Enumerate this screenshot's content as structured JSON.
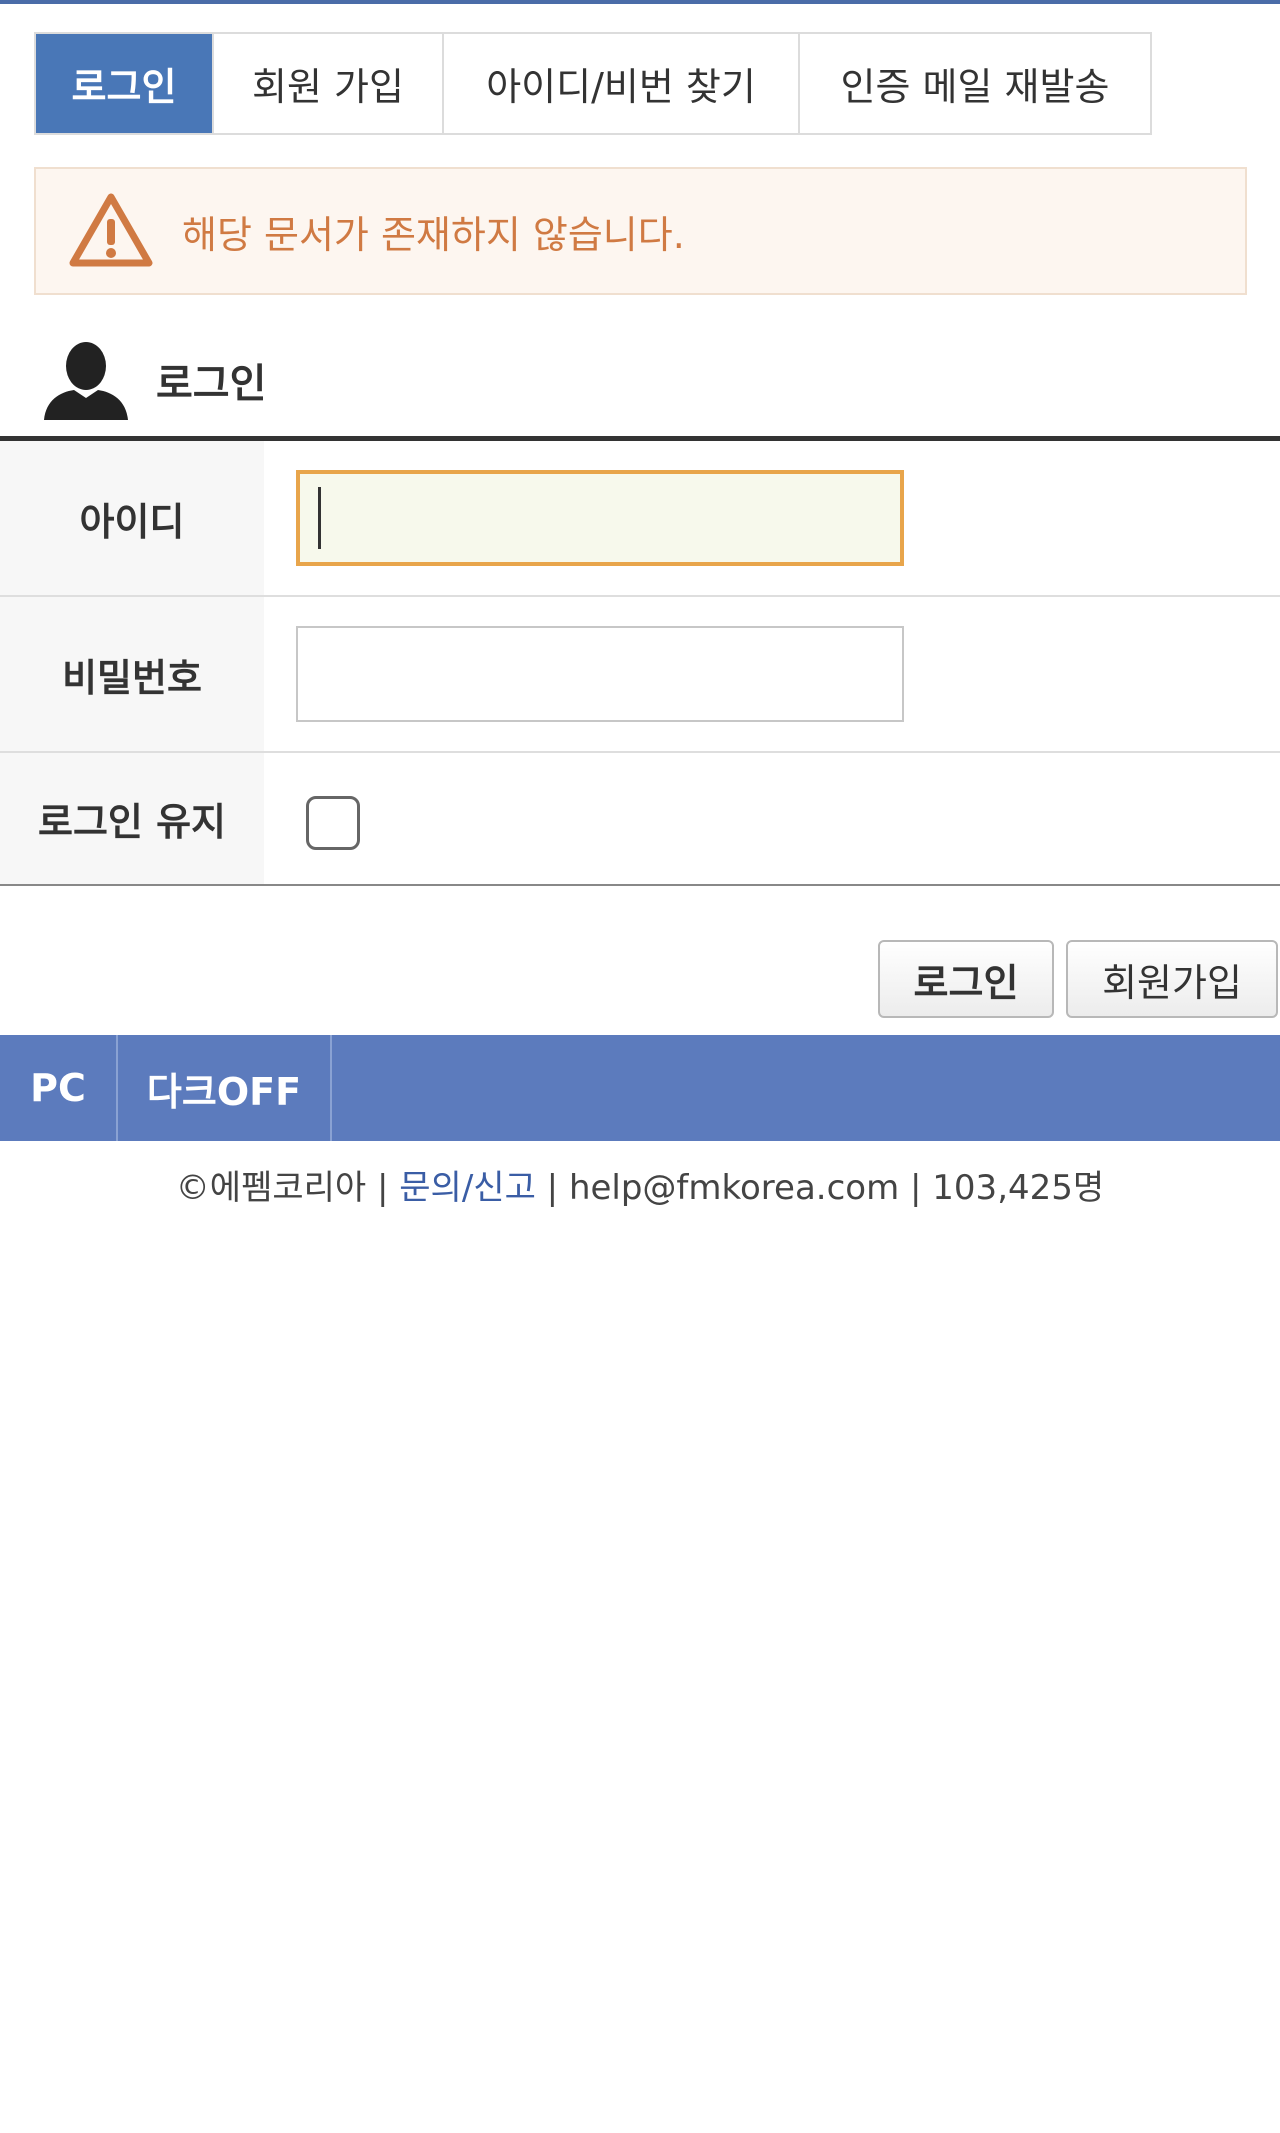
{
  "tabs": [
    {
      "label": "로그인",
      "active": true
    },
    {
      "label": "회원 가입",
      "active": false
    },
    {
      "label": "아이디/비번 찾기",
      "active": false
    },
    {
      "label": "인증 메일 재발송",
      "active": false
    }
  ],
  "alert": {
    "icon": "warning-icon",
    "message": "해당 문서가 존재하지 않습니다."
  },
  "section": {
    "icon": "user-icon",
    "title": "로그인"
  },
  "form": {
    "id_label": "아이디",
    "id_value": "",
    "password_label": "비밀번호",
    "password_value": "",
    "keep_login_label": "로그인 유지",
    "keep_login_checked": false
  },
  "buttons": {
    "login_label": "로그인",
    "join_label": "회원가입"
  },
  "bottom_bar": {
    "pc_label": "PC",
    "dark_label": "다크OFF"
  },
  "footer": {
    "copyright": "©에펨코리아",
    "sep1": " | ",
    "inquiry_link": "문의/신고",
    "sep2": " | ",
    "email": "help@fmkorea.com",
    "sep3": " | ",
    "user_count": "103,425명"
  },
  "colors": {
    "accent": "#4977b7",
    "bar": "#5c7bbd",
    "alert_text": "#d07a43",
    "input_focus_border": "#e8a54b"
  }
}
